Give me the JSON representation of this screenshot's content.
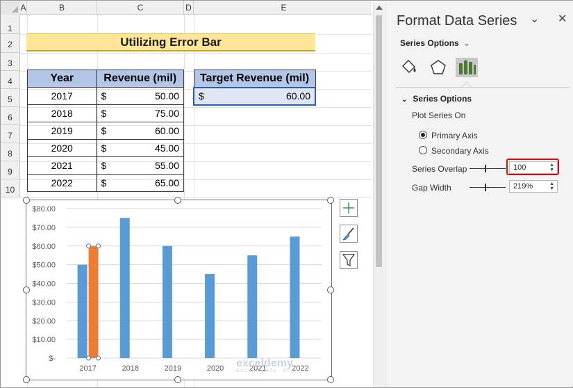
{
  "sheet": {
    "columns": [
      "A",
      "B",
      "C",
      "D",
      "E"
    ],
    "rows": [
      "1",
      "2",
      "3",
      "4",
      "5",
      "6",
      "7",
      "8",
      "9",
      "10"
    ],
    "title": "Utilizing Error Bar",
    "revenue_table": {
      "headers": [
        "Year",
        "Revenue (mil)"
      ],
      "rows": [
        {
          "year": "2017",
          "currency": "$",
          "value": "50.00"
        },
        {
          "year": "2018",
          "currency": "$",
          "value": "75.00"
        },
        {
          "year": "2019",
          "currency": "$",
          "value": "60.00"
        },
        {
          "year": "2020",
          "currency": "$",
          "value": "45.00"
        },
        {
          "year": "2021",
          "currency": "$",
          "value": "55.00"
        },
        {
          "year": "2022",
          "currency": "$",
          "value": "65.00"
        }
      ]
    },
    "target_table": {
      "header": "Target Revenue (mil)",
      "currency": "$",
      "value": "60.00"
    }
  },
  "chart_data": {
    "type": "bar",
    "categories": [
      "2017",
      "2018",
      "2019",
      "2020",
      "2021",
      "2022"
    ],
    "series": [
      {
        "values": [
          50,
          75,
          60,
          45,
          55,
          65
        ],
        "color": "#5b9bd5"
      },
      {
        "values": [
          60,
          null,
          null,
          null,
          null,
          null
        ],
        "color": "#ed7d31"
      }
    ],
    "ylim": [
      0,
      80
    ],
    "yticks": [
      0,
      10,
      20,
      30,
      40,
      50,
      60,
      70,
      80
    ],
    "ytick_labels": [
      "$-",
      "$10.00",
      "$20.00",
      "$30.00",
      "$40.00",
      "$50.00",
      "$60.00",
      "$70.00",
      "$80.00"
    ],
    "grid": true,
    "title": "",
    "xlabel": "",
    "ylabel": ""
  },
  "chart_tools": {
    "elements_icon": "plus-icon",
    "styles_icon": "paintbrush-icon",
    "filters_icon": "funnel-icon"
  },
  "watermark": {
    "brand": "exceldemy",
    "tagline": "EXCEL · DATA · BI"
  },
  "pane": {
    "title": "Format Data Series",
    "series_options_dropdown": "Series Options",
    "section_title": "Series Options",
    "plot_series_on": "Plot Series On",
    "primary_axis": "Primary Axis",
    "secondary_axis": "Secondary Axis",
    "series_overlap_label": "Series Overlap",
    "series_overlap_value": "100",
    "gap_width_label": "Gap Width",
    "gap_width_value": "219%",
    "accent_color": "#4c7a34"
  }
}
